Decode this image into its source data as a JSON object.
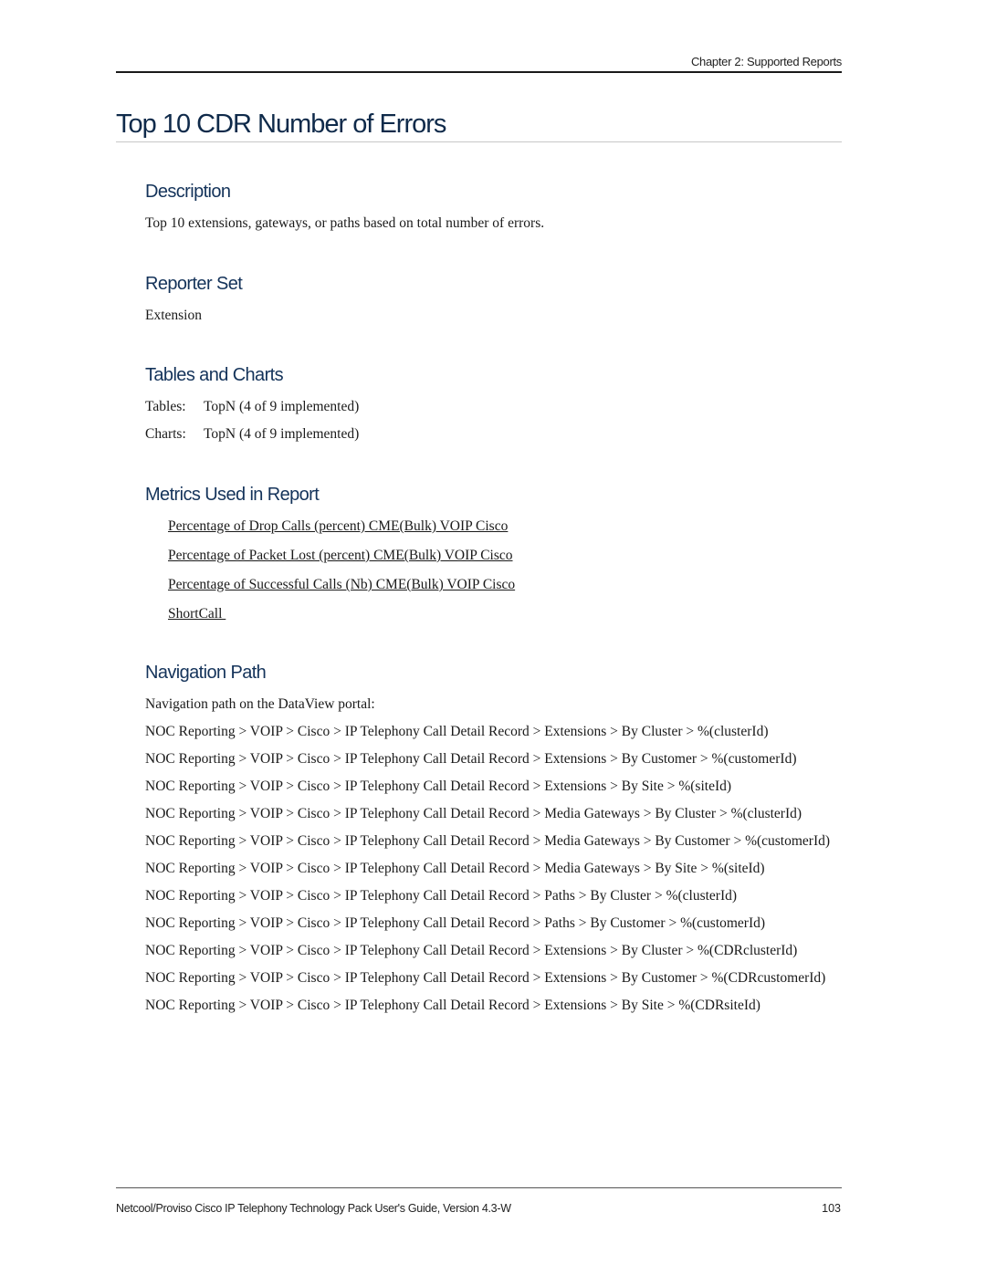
{
  "header": {
    "chapter": "Chapter 2: Supported Reports"
  },
  "title": "Top 10 CDR Number of Errors",
  "sections": {
    "description": {
      "heading": "Description",
      "text": "Top 10 extensions, gateways, or paths based on total number of errors."
    },
    "reporter_set": {
      "heading": "Reporter Set",
      "text": "Extension"
    },
    "tables_charts": {
      "heading": "Tables and Charts",
      "tables_label": "Tables:",
      "tables_value": "TopN (4 of 9 implemented)",
      "charts_label": "Charts:",
      "charts_value": "TopN (4 of 9 implemented)"
    },
    "metrics": {
      "heading": "Metrics Used in Report",
      "links": [
        "Percentage of Drop Calls (percent) CME(Bulk) VOIP Cisco",
        "Percentage of Packet Lost (percent) CME(Bulk) VOIP Cisco",
        "Percentage of Successful Calls (Nb) CME(Bulk) VOIP Cisco",
        "ShortCall "
      ]
    },
    "navigation": {
      "heading": "Navigation Path",
      "intro": "Navigation path on the DataView portal:",
      "paths": [
        "NOC Reporting >  VOIP >  Cisco >  IP Telephony Call Detail Record >  Extensions >  By Cluster >  %(clusterId)",
        "NOC Reporting >  VOIP >  Cisco >  IP Telephony Call Detail Record >  Extensions >  By Customer > %(customerId)",
        "NOC Reporting >  VOIP >  Cisco >  IP Telephony Call Detail Record >  Extensions >  By Site >  %(siteId)",
        "NOC Reporting >  VOIP >  Cisco >  IP Telephony Call Detail Record >  Media Gateways >  By Cluster > %(clusterId)",
        "NOC Reporting >  VOIP >  Cisco >  IP Telephony Call Detail Record >  Media Gateways >  By Customer > %(customerId)",
        "NOC Reporting >  VOIP >  Cisco >  IP Telephony Call Detail Record >  Media Gateways >  By Site >  %(siteId)",
        "NOC Reporting >  VOIP >  Cisco >  IP Telephony Call Detail Record >  Paths >  By Cluster >  %(clusterId)",
        "NOC Reporting >  VOIP >  Cisco >  IP Telephony Call Detail Record >  Paths >  By Customer >  %(customerId)",
        "NOC Reporting >  VOIP >  Cisco >  IP Telephony Call Detail Record >  Extensions >  By Cluster > %(CDRclusterId)",
        "NOC Reporting >  VOIP >  Cisco >  IP Telephony Call Detail Record >  Extensions >  By Customer > %(CDRcustomerId)",
        "NOC Reporting >  VOIP >  Cisco >  IP Telephony Call Detail Record >  Extensions >  By Site >  %(CDRsiteId)"
      ]
    }
  },
  "footer": {
    "text": "Netcool/Proviso Cisco IP Telephony Technology Pack User's Guide, Version 4.3-W",
    "page": "103"
  }
}
